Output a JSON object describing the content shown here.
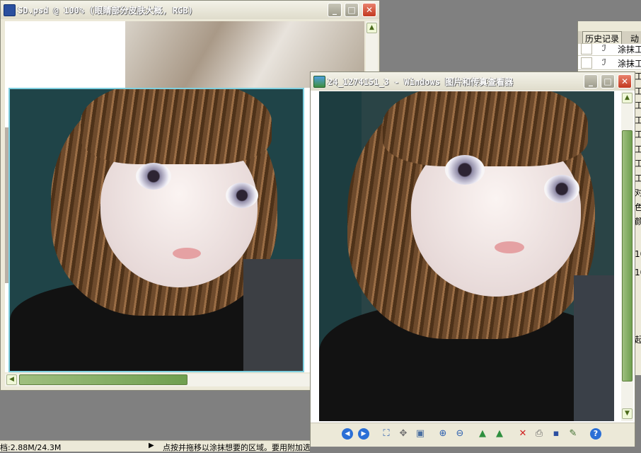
{
  "ps_window": {
    "title": "SD.psd @ 100% (眼睛部分皮肤大概, RGB)"
  },
  "viewer_window": {
    "title": "24_1274151_3 - Windows 图片和传真查看器",
    "toolbar_icons": [
      "previous-image-icon",
      "next-image-icon",
      "best-fit-icon",
      "actual-size-icon",
      "slideshow-icon",
      "zoom-in-icon",
      "zoom-out-icon",
      "rotate-clockwise-icon",
      "rotate-counterclockwise-icon",
      "delete-icon",
      "print-icon",
      "save-icon",
      "edit-icon",
      "help-icon"
    ]
  },
  "history_panel": {
    "tabs": [
      "历史记录",
      "动"
    ],
    "items": [
      "涂抹工",
      "涂抹工"
    ],
    "tool_labels": [
      "工",
      "工",
      "工",
      "工",
      "工",
      "工",
      "工",
      "工",
      "对",
      "色",
      "颜"
    ],
    "values": [
      "10",
      "10"
    ],
    "button_label": "起"
  },
  "status_bar": {
    "doc_info": "档:2.88M/24.3M",
    "hint": "点按并拖移以涂抹想要的区域。要用附加选项，使用 Shift、Alt 和 Ctrl 键。"
  },
  "colors": {
    "desktop": "#808080",
    "window_face": "#ece9d8",
    "close_button": "#c2391f",
    "photo_bg": "#1f4448"
  }
}
